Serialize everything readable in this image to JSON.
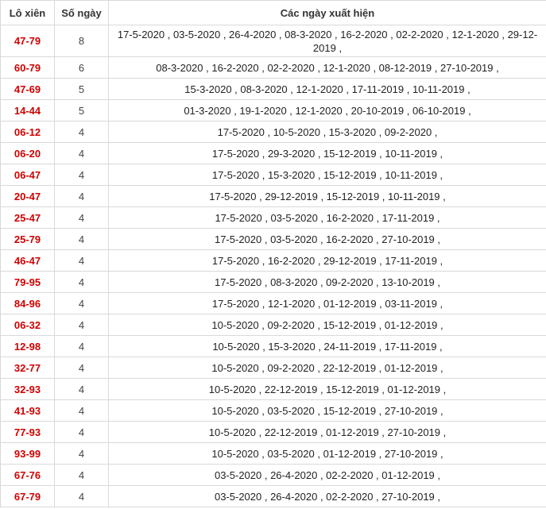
{
  "table": {
    "headers": [
      "Lô xiên",
      "Số ngày",
      "Các ngày xuất hiện"
    ],
    "rows": [
      {
        "pair": "47-79",
        "count": "8",
        "dates": "17-5-2020 , 03-5-2020 , 26-4-2020 , 08-3-2020 , 16-2-2020 , 02-2-2020 , 12-1-2020 , 29-12-2019 ,"
      },
      {
        "pair": "60-79",
        "count": "6",
        "dates": "08-3-2020 , 16-2-2020 , 02-2-2020 , 12-1-2020 , 08-12-2019 , 27-10-2019 ,"
      },
      {
        "pair": "47-69",
        "count": "5",
        "dates": "15-3-2020 , 08-3-2020 , 12-1-2020 , 17-11-2019 , 10-11-2019 ,"
      },
      {
        "pair": "14-44",
        "count": "5",
        "dates": "01-3-2020 , 19-1-2020 , 12-1-2020 , 20-10-2019 , 06-10-2019 ,"
      },
      {
        "pair": "06-12",
        "count": "4",
        "dates": "17-5-2020 , 10-5-2020 , 15-3-2020 , 09-2-2020 ,"
      },
      {
        "pair": "06-20",
        "count": "4",
        "dates": "17-5-2020 , 29-3-2020 , 15-12-2019 , 10-11-2019 ,"
      },
      {
        "pair": "06-47",
        "count": "4",
        "dates": "17-5-2020 , 15-3-2020 , 15-12-2019 , 10-11-2019 ,"
      },
      {
        "pair": "20-47",
        "count": "4",
        "dates": "17-5-2020 , 29-12-2019 , 15-12-2019 , 10-11-2019 ,"
      },
      {
        "pair": "25-47",
        "count": "4",
        "dates": "17-5-2020 , 03-5-2020 , 16-2-2020 , 17-11-2019 ,"
      },
      {
        "pair": "25-79",
        "count": "4",
        "dates": "17-5-2020 , 03-5-2020 , 16-2-2020 , 27-10-2019 ,"
      },
      {
        "pair": "46-47",
        "count": "4",
        "dates": "17-5-2020 , 16-2-2020 , 29-12-2019 , 17-11-2019 ,"
      },
      {
        "pair": "79-95",
        "count": "4",
        "dates": "17-5-2020 , 08-3-2020 , 09-2-2020 , 13-10-2019 ,"
      },
      {
        "pair": "84-96",
        "count": "4",
        "dates": "17-5-2020 , 12-1-2020 , 01-12-2019 , 03-11-2019 ,"
      },
      {
        "pair": "06-32",
        "count": "4",
        "dates": "10-5-2020 , 09-2-2020 , 15-12-2019 , 01-12-2019 ,"
      },
      {
        "pair": "12-98",
        "count": "4",
        "dates": "10-5-2020 , 15-3-2020 , 24-11-2019 , 17-11-2019 ,"
      },
      {
        "pair": "32-77",
        "count": "4",
        "dates": "10-5-2020 , 09-2-2020 , 22-12-2019 , 01-12-2019 ,"
      },
      {
        "pair": "32-93",
        "count": "4",
        "dates": "10-5-2020 , 22-12-2019 , 15-12-2019 , 01-12-2019 ,"
      },
      {
        "pair": "41-93",
        "count": "4",
        "dates": "10-5-2020 , 03-5-2020 , 15-12-2019 , 27-10-2019 ,"
      },
      {
        "pair": "77-93",
        "count": "4",
        "dates": "10-5-2020 , 22-12-2019 , 01-12-2019 , 27-10-2019 ,"
      },
      {
        "pair": "93-99",
        "count": "4",
        "dates": "10-5-2020 , 03-5-2020 , 01-12-2019 , 27-10-2019 ,"
      },
      {
        "pair": "67-76",
        "count": "4",
        "dates": "03-5-2020 , 26-4-2020 , 02-2-2020 , 01-12-2019 ,"
      },
      {
        "pair": "67-79",
        "count": "4",
        "dates": "03-5-2020 , 26-4-2020 , 02-2-2020 , 27-10-2019 ,"
      }
    ]
  }
}
